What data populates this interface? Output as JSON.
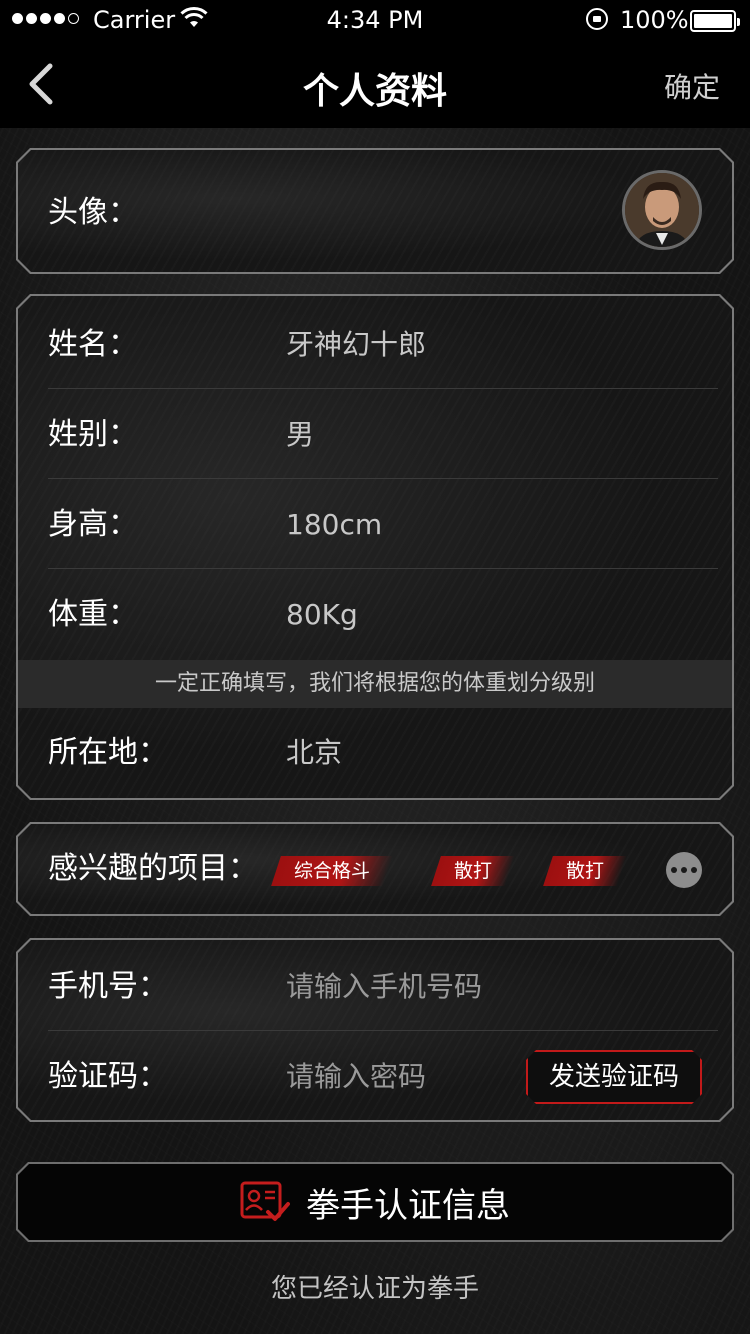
{
  "status_bar": {
    "carrier": "Carrier",
    "time": "4:34 PM",
    "battery": "100%"
  },
  "nav": {
    "title": "个人资料",
    "confirm": "确定"
  },
  "avatar_section": {
    "label": "头像："
  },
  "profile": {
    "name_label": "姓名：",
    "name_value": "牙神幻十郎",
    "gender_label": "姓别：",
    "gender_value": "男",
    "height_label": "身高：",
    "height_value": "180cm",
    "weight_label": "体重：",
    "weight_value": "80Kg",
    "weight_notice": "一定正确填写，我们将根据您的体重划分级别",
    "location_label": "所在地：",
    "location_value": "北京"
  },
  "interests": {
    "label": "感兴趣的项目：",
    "tags": [
      "综合格斗",
      "散打",
      "散打"
    ]
  },
  "contact": {
    "phone_label": "手机号：",
    "phone_placeholder": "请输入手机号码",
    "code_label": "验证码：",
    "code_placeholder": "请输入密码",
    "send_code": "发送验证码"
  },
  "certification": {
    "button_label": "拳手认证信息",
    "footer_text": "您已经认证为拳手"
  },
  "colors": {
    "accent_red": "#b01515",
    "background": "#141414"
  }
}
